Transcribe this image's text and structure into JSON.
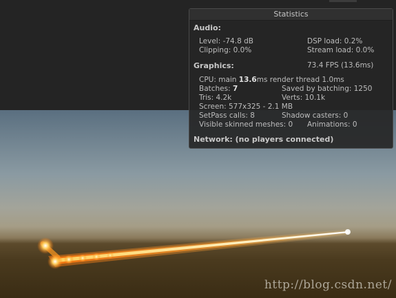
{
  "statistics": {
    "title": "Statistics",
    "audio": {
      "header": "Audio:",
      "level": "Level: -74.8 dB",
      "dsp_load": "DSP load: 0.2%",
      "clipping": "Clipping: 0.0%",
      "stream_load": "Stream load: 0.0%"
    },
    "graphics": {
      "header": "Graphics:",
      "fps": "73.4 FPS (13.6ms)",
      "cpu_prefix": "CPU: main ",
      "cpu_main": "13.6",
      "cpu_suffix": "ms  render thread 1.0ms",
      "batches_prefix": "Batches: ",
      "batches": "7",
      "saved_by_batching": "Saved by batching: 1250",
      "tris": "Tris: 4.2k",
      "verts": "Verts: 10.1k",
      "screen": "Screen: 577x325 - 2.1 MB",
      "setpass": "SetPass calls: 8",
      "shadow_casters": "Shadow casters: 0",
      "visible_skinned": "Visible skinned meshes: 0",
      "animations": "Animations: 0"
    },
    "network": "Network: (no players connected)"
  },
  "watermark": "http://blog.csdn.net/"
}
